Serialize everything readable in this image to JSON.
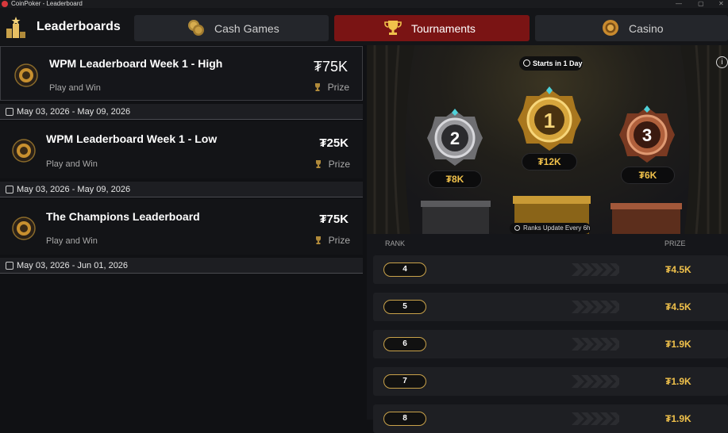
{
  "window": {
    "title": "CoinPoker - Leaderboard"
  },
  "nav": {
    "brand": "Leaderboards",
    "tabs": [
      {
        "label": "Cash Games",
        "icon": "coins-icon"
      },
      {
        "label": "Tournaments",
        "icon": "trophy-icon",
        "active": true
      },
      {
        "label": "Casino",
        "icon": "casino-chip-icon"
      }
    ]
  },
  "leaderboards": [
    {
      "name": "WPM Leaderboard Week 1 - High",
      "subtitle": "Play and Win",
      "amount": "₮75K",
      "prize_label": "Prize",
      "dates": "May 03, 2026 - May 09, 2026",
      "selected": true
    },
    {
      "name": "WPM Leaderboard Week 1 - Low",
      "subtitle": "Play and Win",
      "amount": "₮25K",
      "prize_label": "Prize",
      "dates": "May 03, 2026 - May 09, 2026"
    },
    {
      "name": "The Champions Leaderboard",
      "subtitle": "Play and Win",
      "amount": "₮75K",
      "prize_label": "Prize",
      "dates": "May 03, 2026 - Jun 01, 2026"
    }
  ],
  "podium": {
    "starts": "Starts in 1 Day",
    "ranks_update": "Ranks Update Every 6h",
    "info": "i",
    "places": [
      {
        "rank": "2",
        "prize": "₮8K"
      },
      {
        "rank": "1",
        "prize": "₮12K"
      },
      {
        "rank": "3",
        "prize": "₮6K"
      }
    ]
  },
  "table": {
    "rank_header": "RANK",
    "prize_header": "PRIZE",
    "rows": [
      {
        "rank": "4",
        "prize": "₮4.5K"
      },
      {
        "rank": "5",
        "prize": "₮4.5K"
      },
      {
        "rank": "6",
        "prize": "₮1.9K"
      },
      {
        "rank": "7",
        "prize": "₮1.9K"
      },
      {
        "rank": "8",
        "prize": "₮1.9K"
      }
    ]
  },
  "colors": {
    "accent_red": "#7a1414",
    "gold": "#f0c14b",
    "bg": "#101114"
  }
}
